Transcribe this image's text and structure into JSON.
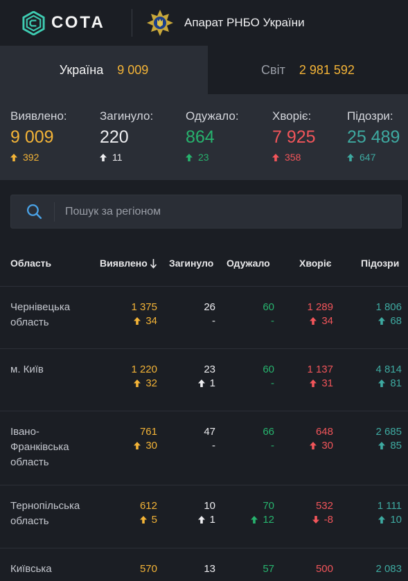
{
  "header": {
    "logo_text": "СОТА",
    "org_name": "Апарат РНБО України"
  },
  "tabs": {
    "ukraine_label": "Україна",
    "ukraine_value": "9 009",
    "world_label": "Світ",
    "world_value": "2 981 592"
  },
  "stats": [
    {
      "label": "Виявлено:",
      "value": "9 009",
      "delta": "392",
      "color": "#f4b437",
      "arrow": "up"
    },
    {
      "label": "Загинуло:",
      "value": "220",
      "delta": "11",
      "color": "#ededf0",
      "arrow": "up"
    },
    {
      "label": "Одужало:",
      "value": "864",
      "delta": "23",
      "color": "#27b36e",
      "arrow": "up"
    },
    {
      "label": "Хворіє:",
      "value": "7 925",
      "delta": "358",
      "color": "#f2555a",
      "arrow": "up"
    },
    {
      "label": "Підозри:",
      "value": "25 489",
      "delta": "647",
      "color": "#3eaaa1",
      "arrow": "up"
    }
  ],
  "search": {
    "placeholder": "Пошук за регіоном"
  },
  "table": {
    "headers": [
      "Область",
      "Виявлено",
      "Загинуло",
      "Одужало",
      "Хворіє",
      "Підозри"
    ],
    "rows": [
      {
        "region": "Чернівецька область",
        "detected": "1 375",
        "detected_d": "34",
        "detected_a": "up",
        "deaths": "26",
        "deaths_d": "-",
        "deaths_a": "",
        "recovered": "60",
        "recovered_d": "-",
        "recovered_a": "",
        "sick": "1 289",
        "sick_d": "34",
        "sick_a": "up",
        "suspect": "1 806",
        "suspect_d": "68",
        "suspect_a": "up"
      },
      {
        "region": "м. Київ",
        "detected": "1 220",
        "detected_d": "32",
        "detected_a": "up",
        "deaths": "23",
        "deaths_d": "1",
        "deaths_a": "up",
        "recovered": "60",
        "recovered_d": "-",
        "recovered_a": "",
        "sick": "1 137",
        "sick_d": "31",
        "sick_a": "up",
        "suspect": "4 814",
        "suspect_d": "81",
        "suspect_a": "up"
      },
      {
        "region": "Івано-Франківська область",
        "detected": "761",
        "detected_d": "30",
        "detected_a": "up",
        "deaths": "47",
        "deaths_d": "-",
        "deaths_a": "",
        "recovered": "66",
        "recovered_d": "-",
        "recovered_a": "",
        "sick": "648",
        "sick_d": "30",
        "sick_a": "up",
        "suspect": "2 685",
        "suspect_d": "85",
        "suspect_a": "up"
      },
      {
        "region": "Тернопільська область",
        "detected": "612",
        "detected_d": "5",
        "detected_a": "up",
        "deaths": "10",
        "deaths_d": "1",
        "deaths_a": "up",
        "recovered": "70",
        "recovered_d": "12",
        "recovered_a": "up",
        "sick": "532",
        "sick_d": "-8",
        "sick_a": "down",
        "suspect": "1 111",
        "suspect_d": "10",
        "suspect_a": "up"
      },
      {
        "region": "Київська",
        "detected": "570",
        "detected_d": "",
        "detected_a": "",
        "deaths": "13",
        "deaths_d": "",
        "deaths_a": "",
        "recovered": "57",
        "recovered_d": "",
        "recovered_a": "",
        "sick": "500",
        "sick_d": "",
        "sick_a": "",
        "suspect": "2 083",
        "suspect_d": "",
        "suspect_a": ""
      }
    ]
  },
  "colors": {
    "detected": "#f4b437",
    "deaths": "#ededf0",
    "recovered": "#27b36e",
    "sick": "#f2555a",
    "suspect": "#3eaaa1",
    "background": "#1b1e24",
    "panel": "#2a2e36"
  },
  "icons": [
    "cota-logo-icon",
    "rnbo-emblem-icon",
    "search-icon",
    "sort-down-arrow-icon",
    "arrow-up-icon",
    "arrow-down-icon"
  ]
}
